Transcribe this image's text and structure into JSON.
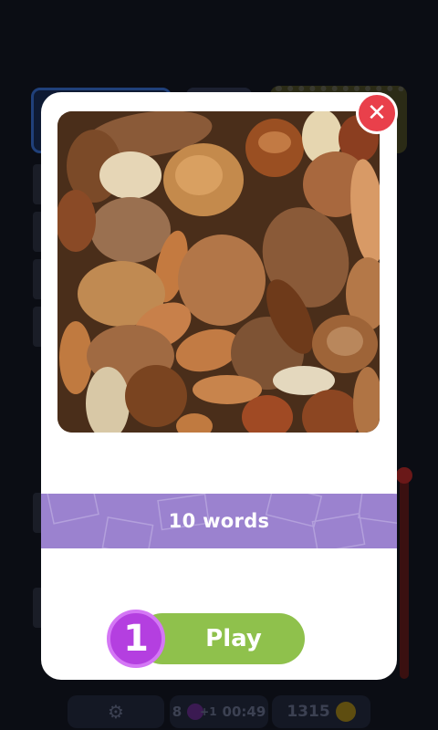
{
  "background": {
    "settings_icon": "gear-icon",
    "hint_count": "8",
    "hint_badge": "+1",
    "timer": "00:49",
    "coins": "1315"
  },
  "modal": {
    "close_icon": "close-icon",
    "image_subject": "mixed-nuts-photo",
    "words_label": "10 words",
    "level_number": "1",
    "play_label": "Play"
  },
  "colors": {
    "modal_bg": "#ffffff",
    "close": "#e9404b",
    "band": "#9b82cf",
    "play": "#8fc14c",
    "level_badge": "#b43fe0"
  }
}
